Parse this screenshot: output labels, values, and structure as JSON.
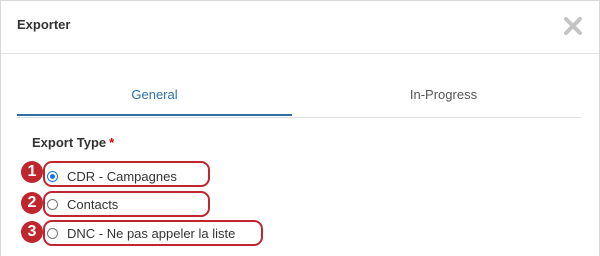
{
  "dialog": {
    "title": "Exporter",
    "close_icon": "close-icon"
  },
  "tabs": [
    {
      "label": "General",
      "active": true
    },
    {
      "label": "In-Progress",
      "active": false
    }
  ],
  "export_type": {
    "label": "Export Type",
    "required_mark": "*",
    "options": [
      {
        "label": "CDR - Campagnes",
        "selected": true,
        "marker": "1"
      },
      {
        "label": "Contacts",
        "selected": false,
        "marker": "2"
      },
      {
        "label": "DNC - Ne pas appeler la liste",
        "selected": false,
        "marker": "3"
      }
    ]
  },
  "colors": {
    "accent": "#2f6fa8",
    "highlight": "#c0262d",
    "required": "#e00000"
  }
}
